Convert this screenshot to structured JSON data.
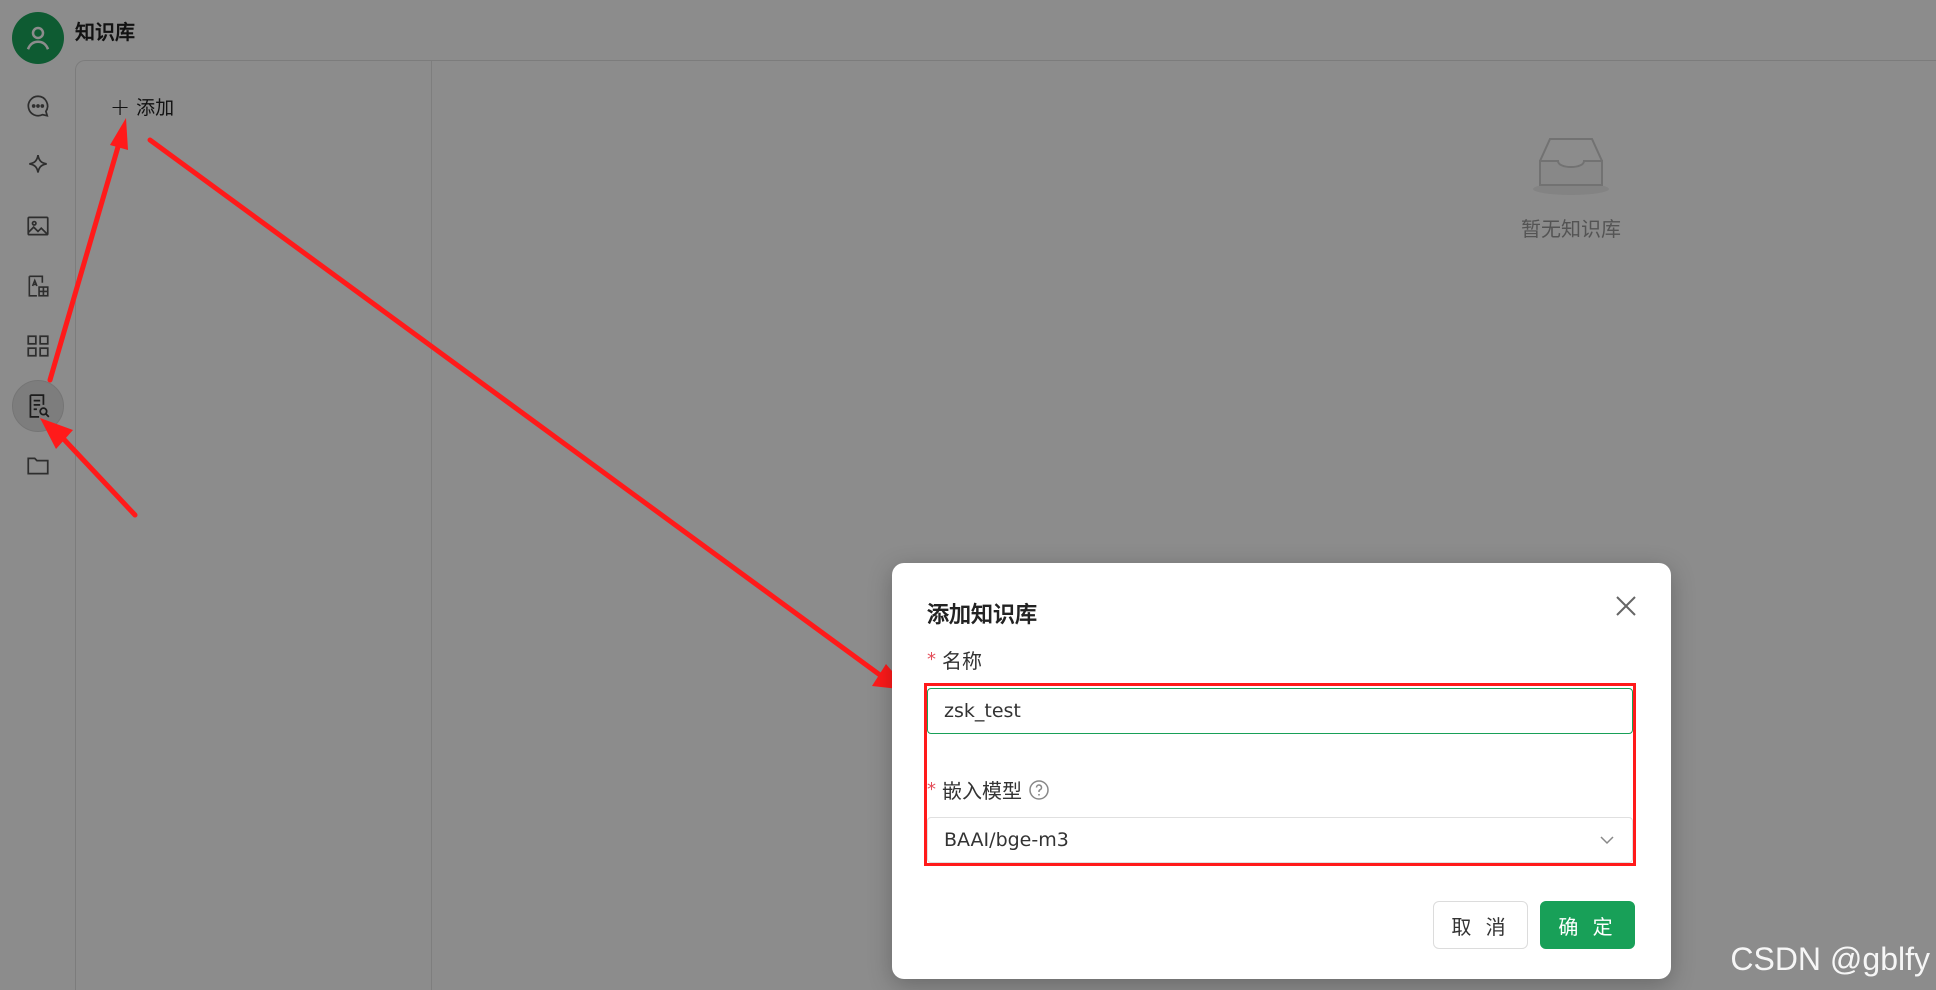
{
  "app": {
    "title": "知识库"
  },
  "rail": {
    "items": [
      {
        "icon": "chat-bubble-icon"
      },
      {
        "icon": "sparkle-icon"
      },
      {
        "icon": "image-icon"
      },
      {
        "icon": "translate-icon"
      },
      {
        "icon": "apps-grid-icon"
      },
      {
        "icon": "knowledge-base-icon",
        "active": true
      },
      {
        "icon": "folder-icon"
      }
    ]
  },
  "kb_list": {
    "add_label": "添加"
  },
  "empty_state": {
    "label": "暂无知识库"
  },
  "modal": {
    "title": "添加知识库",
    "name_field": {
      "label": "名称",
      "value": "zsk_test"
    },
    "model_field": {
      "label": "嵌入模型",
      "value": "BAAI/bge-m3"
    },
    "cancel_label": "取 消",
    "confirm_label": "确 定"
  },
  "watermark": "CSDN @gblfy",
  "colors": {
    "accent": "#18a058",
    "annotation": "#ff1a1a",
    "required": "#e34d59"
  }
}
